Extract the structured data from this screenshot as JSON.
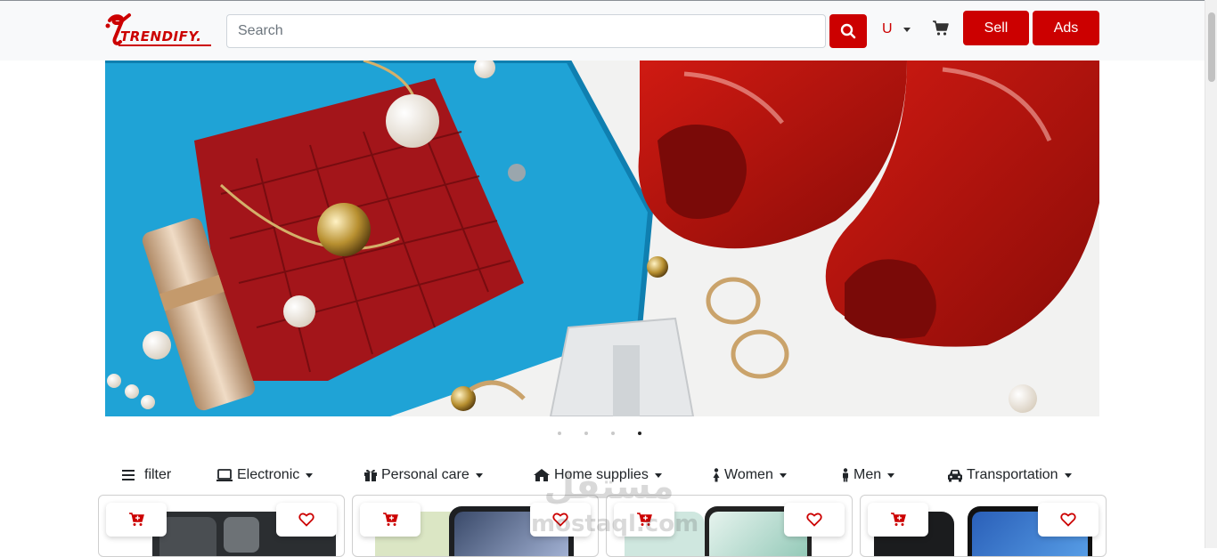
{
  "header": {
    "logo_text": "TRENDIFY.",
    "search_placeholder": "Search",
    "user_initial": "U",
    "sell_label": "Sell",
    "ads_label": "Ads"
  },
  "icons": {
    "search": "search-icon",
    "cart": "cart-icon",
    "add_to_cart": "cart-plus-icon",
    "wishlist": "heart-icon"
  },
  "colors": {
    "brand_red": "#cc0000",
    "navbar_bg": "#f8f9fa"
  },
  "carousel": {
    "slide_count": 4,
    "active_index": 3
  },
  "categories": [
    {
      "label": "filter",
      "icon": "menu-icon",
      "has_dropdown": false
    },
    {
      "label": "Electronic",
      "icon": "laptop-icon",
      "has_dropdown": true
    },
    {
      "label": "Personal care",
      "icon": "gift-icon",
      "has_dropdown": true
    },
    {
      "label": "Home supplies",
      "icon": "home-icon",
      "has_dropdown": true
    },
    {
      "label": "Women",
      "icon": "female-icon",
      "has_dropdown": true
    },
    {
      "label": "Men",
      "icon": "male-icon",
      "has_dropdown": true
    },
    {
      "label": "Transportation",
      "icon": "car-icon",
      "has_dropdown": true
    }
  ],
  "watermark": {
    "arabic": "مستقل",
    "latin": "mostaql.com"
  }
}
